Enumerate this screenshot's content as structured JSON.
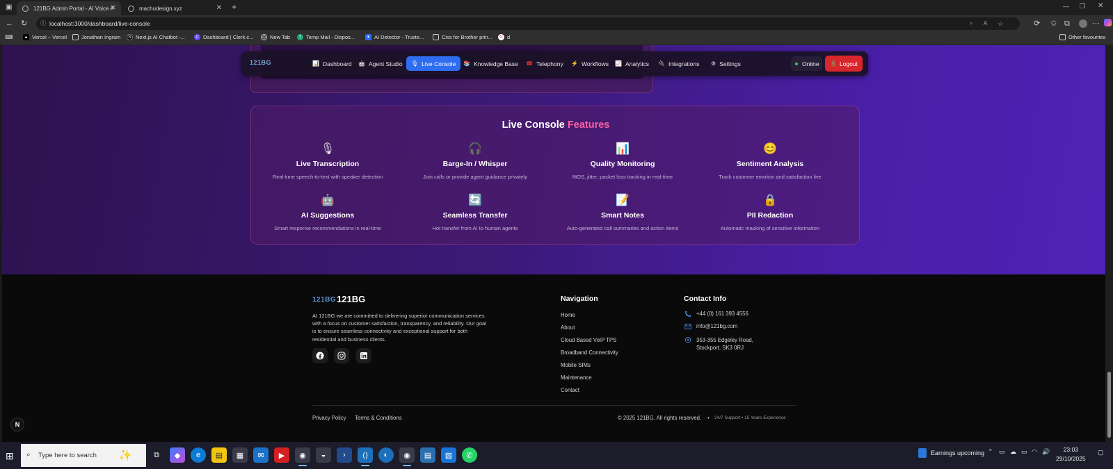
{
  "browser": {
    "tabs": [
      {
        "title": "121BG Admin Portal - AI Voice A",
        "active": true
      },
      {
        "title": "machudesign.xyz",
        "active": false
      }
    ],
    "url": "localhost:3000/dashboard/live-console",
    "bookmarks": [
      "Vercel – Vercel",
      "Jonathan Ingram",
      "Next.js AI Chatbot -...",
      "Dashboard | Clerk.c...",
      "New Tab",
      "Temp Mail - Dispos...",
      "AI Detector - Truste...",
      "Ciss for Brother prin...",
      "d"
    ],
    "other_favourites": "Other favourites"
  },
  "app_nav": {
    "logo": "121BG",
    "items": [
      {
        "label": "Dashboard",
        "icon": "📊"
      },
      {
        "label": "Agent Studio",
        "icon": "🤖"
      },
      {
        "label": "Live Console",
        "icon": "🎙",
        "active": true
      },
      {
        "label": "Knowledge Base",
        "icon": "📚"
      },
      {
        "label": "Telephony",
        "icon": "☎"
      },
      {
        "label": "Workflows",
        "icon": "⚡"
      },
      {
        "label": "Analytics",
        "icon": "📈"
      },
      {
        "label": "Integrations",
        "icon": "🔌"
      },
      {
        "label": "Settings",
        "icon": "⚙"
      }
    ],
    "status": "Online",
    "logout": "Logout"
  },
  "features": {
    "title_main": "Live Console",
    "title_highlight": "Features",
    "items": [
      {
        "icon": "🎙",
        "name": "Live Transcription",
        "desc": "Real-time speech-to-text with speaker detection"
      },
      {
        "icon": "🎧",
        "name": "Barge-In / Whisper",
        "desc": "Join calls or provide agent guidance privately"
      },
      {
        "icon": "📊",
        "name": "Quality Monitoring",
        "desc": "MOS, jitter, packet loss tracking in real-time"
      },
      {
        "icon": "😊",
        "name": "Sentiment Analysis",
        "desc": "Track customer emotion and satisfaction live"
      },
      {
        "icon": "🤖",
        "name": "AI Suggestions",
        "desc": "Smart response recommendations in real-time"
      },
      {
        "icon": "🔄",
        "name": "Seamless Transfer",
        "desc": "Hot transfer from AI to human agents"
      },
      {
        "icon": "📝",
        "name": "Smart Notes",
        "desc": "Auto-generated call summaries and action items"
      },
      {
        "icon": "🔒",
        "name": "PII Redaction",
        "desc": "Automatic masking of sensitive information"
      }
    ]
  },
  "footer": {
    "logo_mark": "121BG",
    "brand": "121BG",
    "about": "At 121BG we are committed to delivering superior communication services with a focus on customer satisfaction, transparency, and reliability. Our goal is to ensure seamless connectivity and exceptional support for both residential and business clients.",
    "navigation_heading": "Navigation",
    "navigation": [
      "Home",
      "About",
      "Cloud Based VoIP TPS",
      "Broadband Connectivity",
      "Mobile SIMs",
      "Maintenance",
      "Contact"
    ],
    "contact_heading": "Contact Info",
    "phone": "+44 (0) 161 393 4556",
    "email": "info@121bg.com",
    "address_line1": "353-355 Edgeley Road,",
    "address_line2": "Stockport, SK3 0RJ",
    "privacy": "Privacy Policy",
    "terms": "Terms & Conditions",
    "copyright": "© 2025 121BG. All rights reserved.",
    "tagline": "24/7 Support • 15 Years Experience"
  },
  "taskbar": {
    "search_placeholder": "Type here to search",
    "news": "Earnings upcoming",
    "time": "23:03",
    "date": "29/10/2025"
  }
}
